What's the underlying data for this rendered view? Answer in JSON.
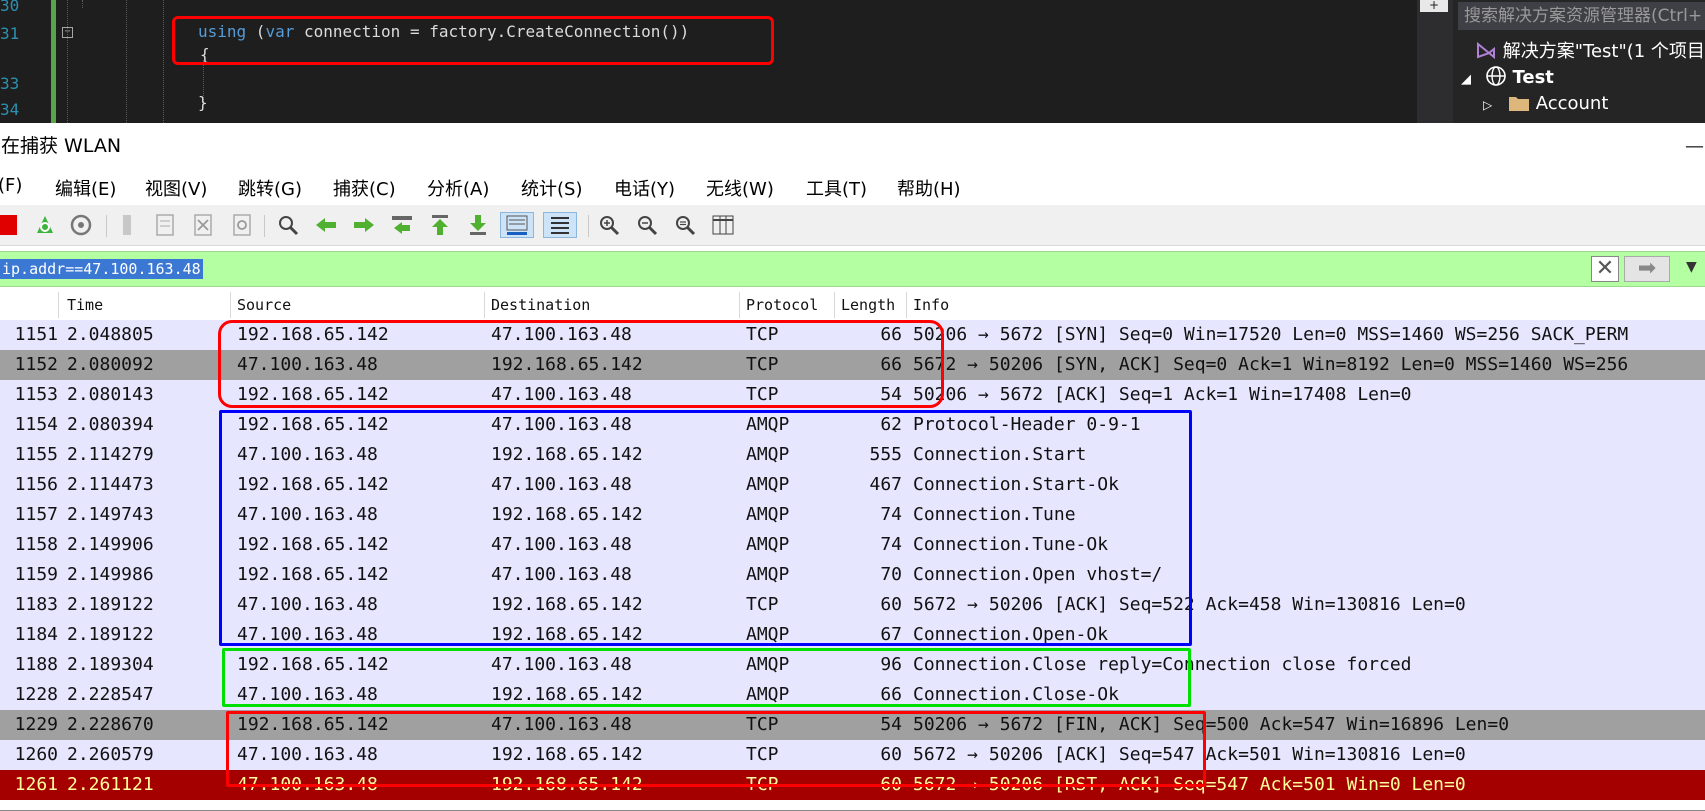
{
  "editor": {
    "line_numbers": [
      "30",
      "31",
      "33",
      "34"
    ],
    "code_line1_kw": "using",
    "code_line1_rest": " (",
    "code_line1_var": "var",
    "code_line1_tail": " connection = factory.CreateConnection())",
    "code_brace_open": "{",
    "code_brace_close": "}",
    "collapse_glyph": "−",
    "scroll_plus": "+"
  },
  "solution_explorer": {
    "search_placeholder": "搜索解决方案资源管理器(Ctrl+",
    "solution_label": "解决方案\"Test\"(1 个项目",
    "project_label": "Test",
    "folder_label": "Account"
  },
  "wireshark": {
    "title": "正在捕获 WLAN",
    "menu": [
      "(F)",
      "编辑(E)",
      "视图(V)",
      "跳转(G)",
      "捕获(C)",
      "分析(A)",
      "统计(S)",
      "电话(Y)",
      "无线(W)",
      "工具(T)",
      "帮助(H)"
    ],
    "filter_text": "ip.addr==47.100.163.48",
    "columns": [
      "Time",
      "Source",
      "Destination",
      "Protocol",
      "Length",
      "Info"
    ],
    "packets": [
      {
        "no": "1151",
        "time": "2.048805",
        "src": "192.168.65.142",
        "dst": "47.100.163.48",
        "proto": "TCP",
        "len": "66",
        "info": "50206 → 5672 [SYN] Seq=0 Win=17520 Len=0 MSS=1460 WS=256 SACK_PERM",
        "bg": "#e7e6ff",
        "fg": "#111111"
      },
      {
        "no": "1152",
        "time": "2.080092",
        "src": "47.100.163.48",
        "dst": "192.168.65.142",
        "proto": "TCP",
        "len": "66",
        "info": "5672 → 50206 [SYN, ACK] Seq=0 Ack=1 Win=8192 Len=0 MSS=1460 WS=256",
        "bg": "#a0a0a0",
        "fg": "#111111"
      },
      {
        "no": "1153",
        "time": "2.080143",
        "src": "192.168.65.142",
        "dst": "47.100.163.48",
        "proto": "TCP",
        "len": "54",
        "info": "50206 → 5672 [ACK] Seq=1 Ack=1 Win=17408 Len=0",
        "bg": "#e7e6ff",
        "fg": "#111111"
      },
      {
        "no": "1154",
        "time": "2.080394",
        "src": "192.168.65.142",
        "dst": "47.100.163.48",
        "proto": "AMQP",
        "len": "62",
        "info": "Protocol-Header 0-9-1",
        "bg": "#e7e6ff",
        "fg": "#111111"
      },
      {
        "no": "1155",
        "time": "2.114279",
        "src": "47.100.163.48",
        "dst": "192.168.65.142",
        "proto": "AMQP",
        "len": "555",
        "info": "Connection.Start",
        "bg": "#e7e6ff",
        "fg": "#111111"
      },
      {
        "no": "1156",
        "time": "2.114473",
        "src": "192.168.65.142",
        "dst": "47.100.163.48",
        "proto": "AMQP",
        "len": "467",
        "info": "Connection.Start-Ok",
        "bg": "#e7e6ff",
        "fg": "#111111"
      },
      {
        "no": "1157",
        "time": "2.149743",
        "src": "47.100.163.48",
        "dst": "192.168.65.142",
        "proto": "AMQP",
        "len": "74",
        "info": "Connection.Tune",
        "bg": "#e7e6ff",
        "fg": "#111111"
      },
      {
        "no": "1158",
        "time": "2.149906",
        "src": "192.168.65.142",
        "dst": "47.100.163.48",
        "proto": "AMQP",
        "len": "74",
        "info": "Connection.Tune-Ok",
        "bg": "#e7e6ff",
        "fg": "#111111"
      },
      {
        "no": "1159",
        "time": "2.149986",
        "src": "192.168.65.142",
        "dst": "47.100.163.48",
        "proto": "AMQP",
        "len": "70",
        "info": "Connection.Open vhost=/",
        "bg": "#e7e6ff",
        "fg": "#111111"
      },
      {
        "no": "1183",
        "time": "2.189122",
        "src": "47.100.163.48",
        "dst": "192.168.65.142",
        "proto": "TCP",
        "len": "60",
        "info": "5672 → 50206 [ACK] Seq=522 Ack=458 Win=130816 Len=0",
        "bg": "#e7e6ff",
        "fg": "#111111"
      },
      {
        "no": "1184",
        "time": "2.189122",
        "src": "47.100.163.48",
        "dst": "192.168.65.142",
        "proto": "AMQP",
        "len": "67",
        "info": "Connection.Open-Ok",
        "bg": "#e7e6ff",
        "fg": "#111111"
      },
      {
        "no": "1188",
        "time": "2.189304",
        "src": "192.168.65.142",
        "dst": "47.100.163.48",
        "proto": "AMQP",
        "len": "96",
        "info": "Connection.Close reply=Connection close forced",
        "bg": "#e7e6ff",
        "fg": "#111111"
      },
      {
        "no": "1228",
        "time": "2.228547",
        "src": "47.100.163.48",
        "dst": "192.168.65.142",
        "proto": "AMQP",
        "len": "66",
        "info": "Connection.Close-Ok",
        "bg": "#e7e6ff",
        "fg": "#111111"
      },
      {
        "no": "1229",
        "time": "2.228670",
        "src": "192.168.65.142",
        "dst": "47.100.163.48",
        "proto": "TCP",
        "len": "54",
        "info": "50206 → 5672 [FIN, ACK] Seq=500 Ack=547 Win=16896 Len=0",
        "bg": "#a0a0a0",
        "fg": "#111111"
      },
      {
        "no": "1260",
        "time": "2.260579",
        "src": "47.100.163.48",
        "dst": "192.168.65.142",
        "proto": "TCP",
        "len": "60",
        "info": "5672 → 50206 [ACK] Seq=547 Ack=501 Win=130816 Len=0",
        "bg": "#e7e6ff",
        "fg": "#111111"
      },
      {
        "no": "1261",
        "time": "2.261121",
        "src": "47.100.163.48",
        "dst": "192.168.65.142",
        "proto": "TCP",
        "len": "60",
        "info": "5672 → 50206 [RST, ACK] Seq=547 Ack=501 Win=0 Len=0",
        "bg": "#a40000",
        "fg": "#fffc9c"
      }
    ]
  },
  "colors": {
    "filter_bg": "#b4ffa2",
    "annotation_red": "#ff0000",
    "annotation_blue": "#0000ff",
    "annotation_green": "#00e000"
  }
}
